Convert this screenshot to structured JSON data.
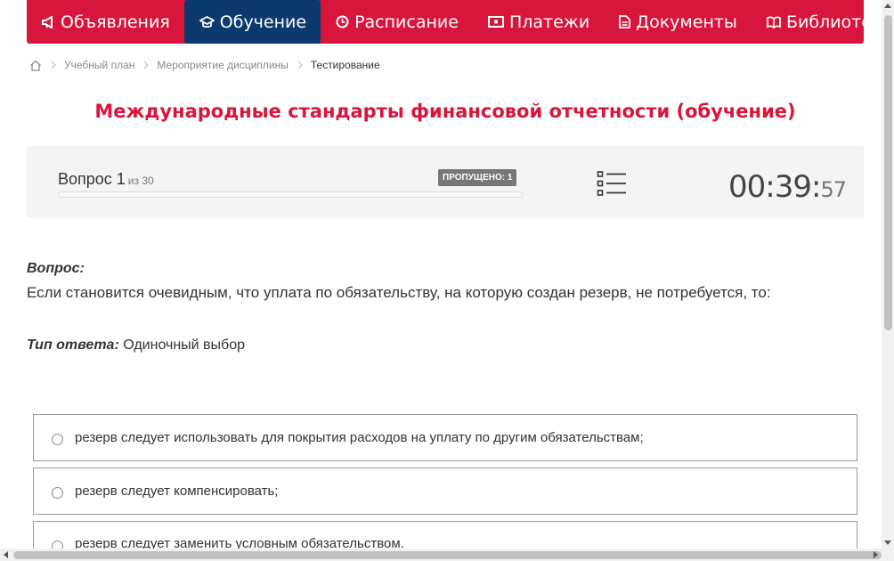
{
  "nav": {
    "items": [
      {
        "label": "Объявления",
        "icon": "megaphone-icon",
        "active": false
      },
      {
        "label": "Обучение",
        "icon": "graduation-cap-icon",
        "active": true
      },
      {
        "label": "Расписание",
        "icon": "clock-icon",
        "active": false
      },
      {
        "label": "Платежи",
        "icon": "money-icon",
        "active": false
      },
      {
        "label": "Документы",
        "icon": "document-icon",
        "active": false
      },
      {
        "label": "Библиотека",
        "icon": "book-icon",
        "active": false
      }
    ],
    "colors": {
      "bar": "#d8153c",
      "active": "#0d3a6e"
    }
  },
  "breadcrumb": {
    "home_icon": "home-icon",
    "items": [
      "Учебный план",
      "Мероприятие дисциплины",
      "Тестирование"
    ]
  },
  "page_title": "Международные стандарты финансовой отчетности (обучение)",
  "question_panel": {
    "label": "Вопрос 1",
    "of_total": "из 30",
    "skipped": "ПРОПУЩЕНО: 1",
    "progress": 0,
    "timer_main": "00:39:",
    "timer_seconds": "57"
  },
  "question": {
    "label": "Вопрос:",
    "text": "Если становится очевидным, что уплата по обязательству, на которую создан резерв, не потребуется, то:",
    "type_label": "Тип ответа:",
    "type_value": "Одиночный выбор"
  },
  "answers": [
    "резерв следует использовать для покрытия расходов на уплату по другим обязательствам;",
    "резерв следует компенсировать;",
    "резерв следует заменить условным обязательством."
  ]
}
